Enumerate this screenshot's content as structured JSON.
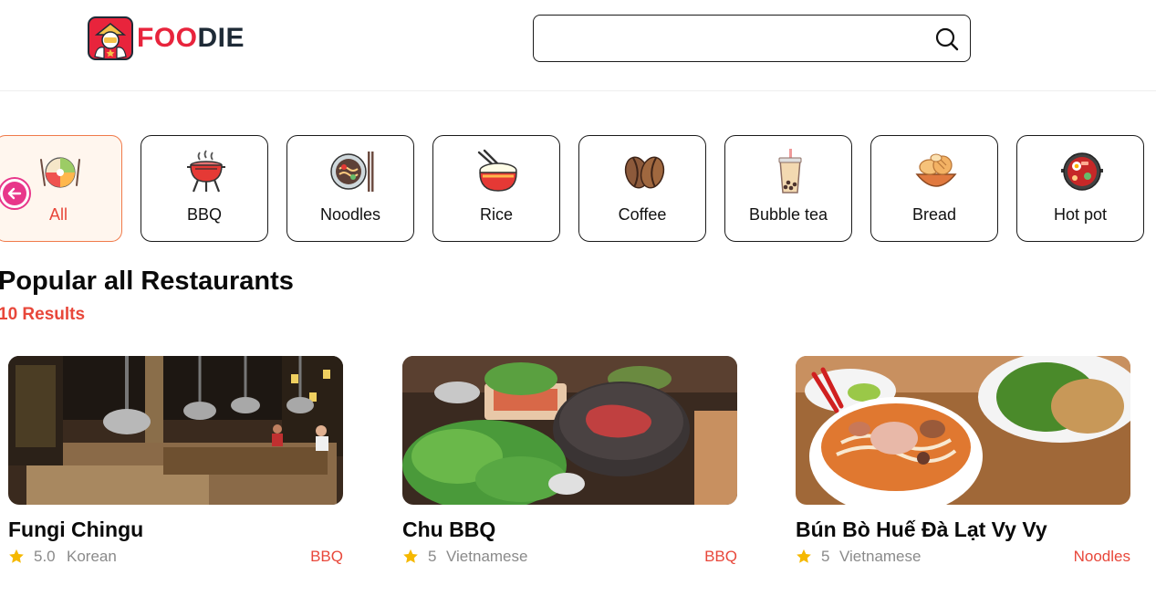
{
  "header": {
    "logo_part1": "FOO",
    "logo_part2": "DIE",
    "search_placeholder": "",
    "search_value": ""
  },
  "categories": [
    {
      "label": "All",
      "icon": "all-food-icon",
      "active": true
    },
    {
      "label": "BBQ",
      "icon": "grill-icon",
      "active": false
    },
    {
      "label": "Noodles",
      "icon": "noodle-bowl-icon",
      "active": false
    },
    {
      "label": "Rice",
      "icon": "rice-bowl-icon",
      "active": false
    },
    {
      "label": "Coffee",
      "icon": "coffee-beans-icon",
      "active": false
    },
    {
      "label": "Bubble tea",
      "icon": "bubble-tea-icon",
      "active": false
    },
    {
      "label": "Bread",
      "icon": "bread-icon",
      "active": false
    },
    {
      "label": "Hot pot",
      "icon": "hot-pot-icon",
      "active": false
    }
  ],
  "section": {
    "title": "Popular all Restaurants",
    "results": "10 Results"
  },
  "restaurants": [
    {
      "name": "Fungi Chingu",
      "rating": "5.0",
      "cuisine": "Korean",
      "tag": "BBQ"
    },
    {
      "name": "Chu BBQ",
      "rating": "5",
      "cuisine": "Vietnamese",
      "tag": "BBQ"
    },
    {
      "name": "Bún Bò Huế Đà Lạt Vy Vy",
      "rating": "5",
      "cuisine": "Vietnamese",
      "tag": "Noodles"
    }
  ],
  "colors": {
    "accent": "#e8473a",
    "brand_red": "#e8243c",
    "brand_dark": "#1e2a36",
    "star": "#f5b800",
    "back_button": "#e8368a"
  }
}
